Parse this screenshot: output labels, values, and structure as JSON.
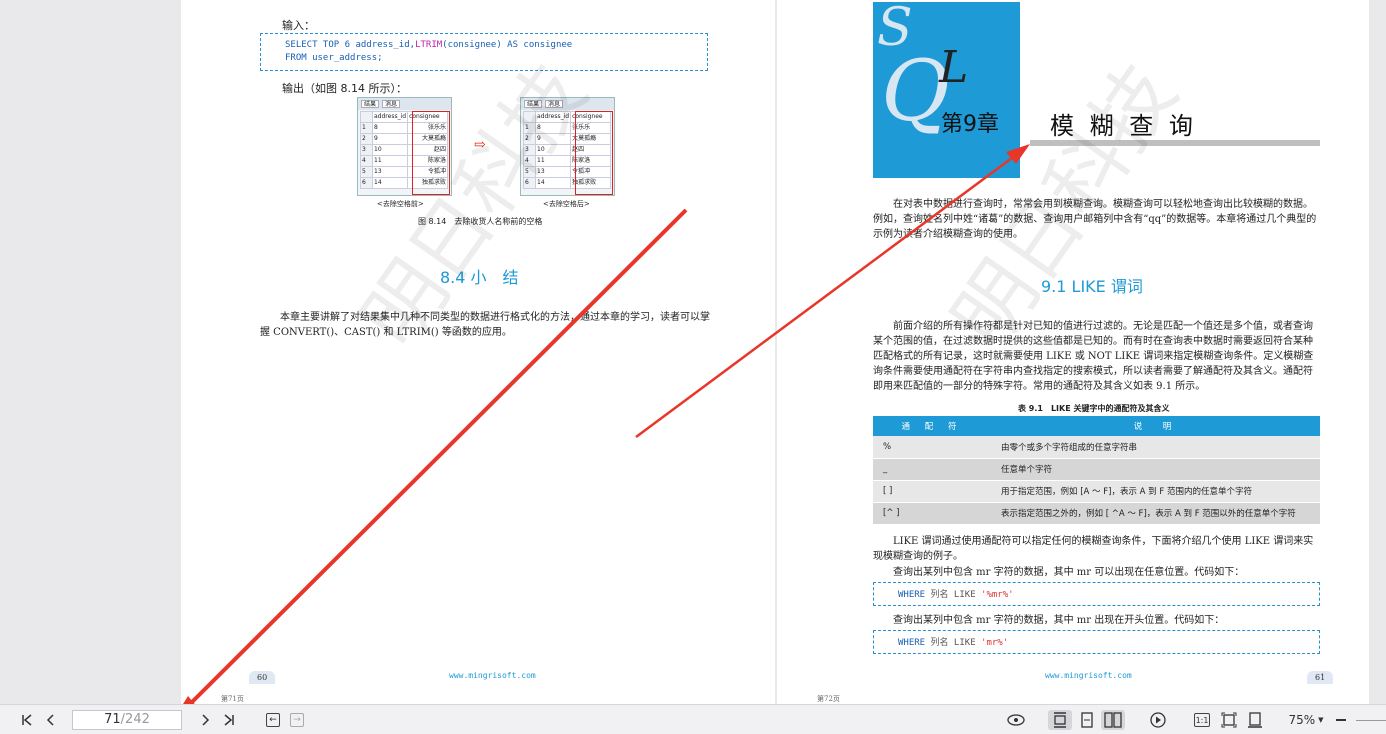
{
  "left_page": {
    "input_label": "输入：",
    "code_lines": [
      {
        "kw1": "SELECT TOP ",
        "num": "6",
        "mid": " address_id,",
        "fn": "LTRIM",
        "rest": "(consignee) AS consignee"
      },
      {
        "kw1": "FROM ",
        "num": "",
        "mid": "user_address;",
        "fn": "",
        "rest": ""
      }
    ],
    "output_label": "输出（如图 8.14 所示）：",
    "grid_tabs": [
      "结果",
      "消息"
    ],
    "grid_headers": [
      "address_id",
      "consignee"
    ],
    "grid_before": [
      [
        "1",
        "8",
        "张乐乐"
      ],
      [
        "2",
        "9",
        "大莫孤瘾"
      ],
      [
        "3",
        "10",
        "赵四"
      ],
      [
        "4",
        "11",
        "陈家洛"
      ],
      [
        "5",
        "13",
        "令狐冲"
      ],
      [
        "6",
        "14",
        "独孤求败"
      ]
    ],
    "grid_after": [
      [
        "1",
        "8",
        "张乐乐"
      ],
      [
        "2",
        "9",
        "大莫孤瘾"
      ],
      [
        "3",
        "10",
        "赵四"
      ],
      [
        "4",
        "11",
        "陈家洛"
      ],
      [
        "5",
        "13",
        "令狐冲"
      ],
      [
        "6",
        "14",
        "独孤求败"
      ]
    ],
    "caption_before": "<去除空格前>",
    "caption_after": "<去除空格后>",
    "arrow_glyph": "⇨",
    "figure_caption": "图 8.14　去除收货人名称前的空格",
    "section_title": "8.4  小　结",
    "summary": "本章主要讲解了对结果集中几种不同类型的数据进行格式化的方法，通过本章的学习，读者可以掌握 CONVERT()、CAST() 和 LTRIM() 等函数的应用。",
    "footer_url": "www.mingrisoft.com",
    "page_number": "60",
    "page_footer": "第71页"
  },
  "right_page": {
    "logo_letters": [
      "S",
      "Q",
      "L"
    ],
    "chapter_no": "第9章",
    "chapter_title": "模 糊 查 询",
    "intro": "在对表中数据进行查询时，常常会用到模糊查询。模糊查询可以轻松地查询出比较模糊的数据。例如，查询姓名列中姓“诸葛”的数据、查询用户邮箱列中含有“qq”的数据等。本章将通过几个典型的示例为读者介绍模糊查询的使用。",
    "section_title": "9.1  LIKE 谓词",
    "para1": "前面介绍的所有操作符都是针对已知的值进行过滤的。无论是匹配一个值还是多个值，或者查询某个范围的值，在过滤数据时提供的这些值都是已知的。而有时在查询表中数据时需要返回符合某种匹配格式的所有记录，这时就需要使用 LIKE 或 NOT LIKE 谓词来指定模糊查询条件。定义模糊查询条件需要使用通配符在字符串内查找指定的搜索模式，所以读者需要了解通配符及其含义。通配符即用来匹配值的一部分的特殊字符。常用的通配符及其含义如表 9.1 所示。",
    "table_caption": "表 9.1　LIKE 关键字中的通配符及其含义",
    "table_headers": [
      "通 配 符",
      "说　明"
    ],
    "table_rows": [
      [
        "%",
        "由零个或多个字符组成的任意字符串"
      ],
      [
        "_",
        "任意单个字符"
      ],
      [
        "[ ]",
        "用于指定范围，例如 [A ～ F]，表示 A 到 F 范围内的任意单个字符"
      ],
      [
        "[^ ]",
        "表示指定范围之外的，例如 [ ^A ～ F]，表示 A 到 F 范围以外的任意单个字符"
      ]
    ],
    "para2": "LIKE 谓词通过使用通配符可以指定任何的模糊查询条件，下面将介绍几个使用 LIKE 谓词来实现模糊查询的例子。",
    "para3": "查询出某列中包含 mr 字符的数据，其中 mr 可以出现在任意位置。代码如下：",
    "code1": {
      "kw": "WHERE ",
      "mid": "列名 LIKE ",
      "str": "'%mr%'"
    },
    "para4": "查询出某列中包含 mr 字符的数据，其中 mr 出现在开头位置。代码如下：",
    "code2": {
      "kw": "WHERE ",
      "mid": "列名 LIKE ",
      "str": "'mr%'"
    },
    "footer_url": "www.mingrisoft.com",
    "page_number": "61",
    "page_footer": "第72页"
  },
  "watermark": "明日科技",
  "toolbar": {
    "current_page": "71",
    "total_pages": "/242",
    "zoom": "75%",
    "fit_label": "1:1",
    "icons": [
      "first-page-icon",
      "prev-page-icon",
      "next-page-icon",
      "last-page-icon",
      "back-icon",
      "forward-icon",
      "eye-icon",
      "continuous-icon",
      "single-page-icon",
      "two-page-icon",
      "play-icon",
      "actual-size-icon",
      "fit-page-icon",
      "fit-width-icon",
      "zoom-out-icon"
    ]
  },
  "colors": {
    "accent": "#1e9ad6",
    "arrow": "#e8362a"
  }
}
